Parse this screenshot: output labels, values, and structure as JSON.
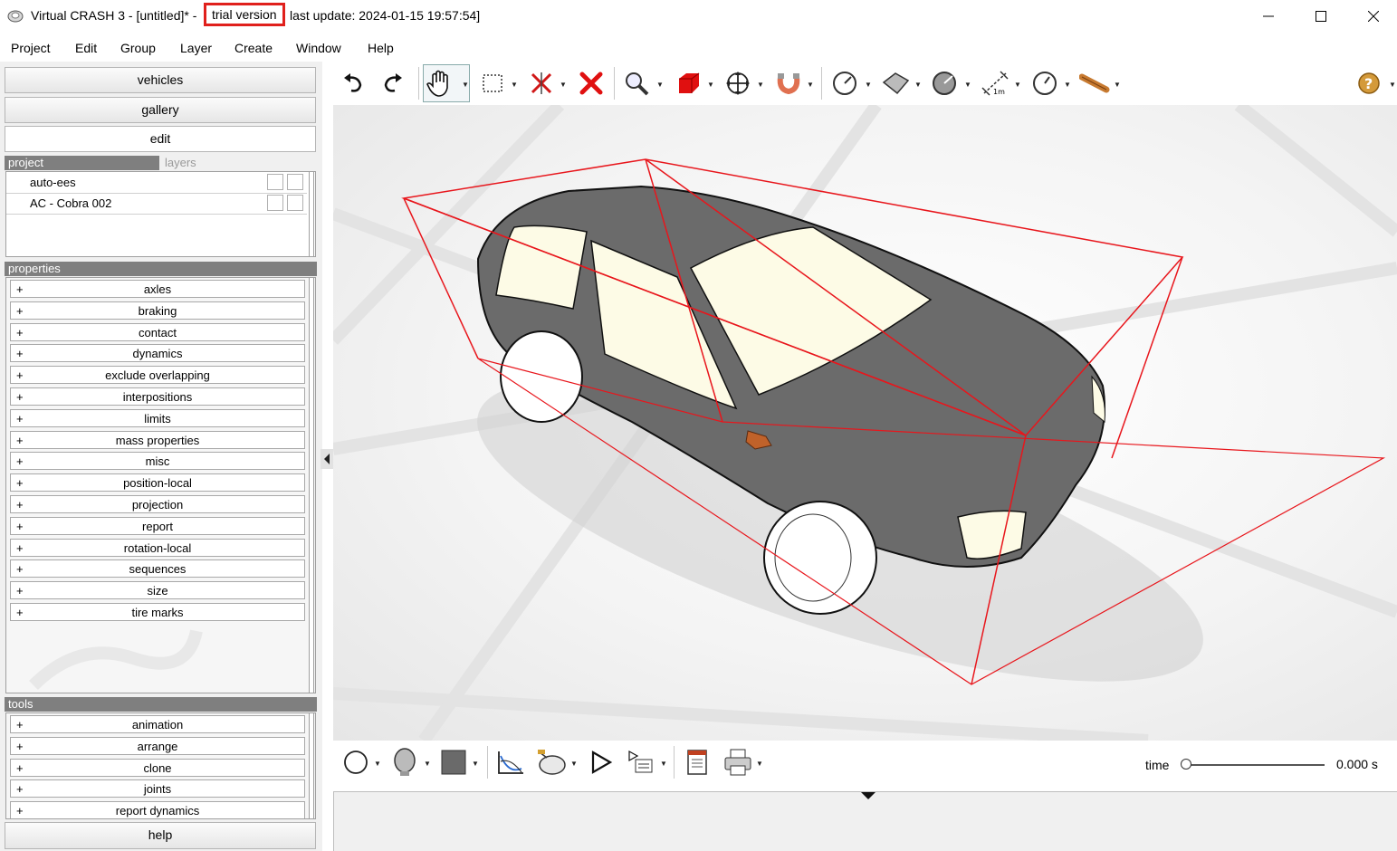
{
  "titlebar": {
    "title": "Virtual CRASH 3 - [untitled]* -",
    "trial": "trial version",
    "update": "last update: 2024-01-15 19:57:54]",
    "buttons": [
      "minimize-icon",
      "maximize-icon",
      "close-icon"
    ]
  },
  "menu": [
    "Project",
    "Edit",
    "Group",
    "Layer",
    "Create",
    "Window",
    "Help"
  ],
  "left": {
    "vehicles": "vehicles",
    "gallery": "gallery",
    "edit": "edit",
    "tab_project": "project",
    "tab_layers": "layers",
    "project_items": [
      "auto-ees",
      "AC - Cobra 002"
    ],
    "properties_header": "properties",
    "properties": [
      "axles",
      "braking",
      "contact",
      "dynamics",
      "exclude overlapping",
      "interpositions",
      "limits",
      "mass properties",
      "misc",
      "position-local",
      "projection",
      "report",
      "rotation-local",
      "sequences",
      "size",
      "tire marks"
    ],
    "tools_header": "tools",
    "tools": [
      "animation",
      "arrange",
      "clone",
      "joints",
      "report dynamics"
    ],
    "help": "help",
    "plus": "+"
  },
  "toolbar_icons": [
    "undo-icon",
    "redo-icon",
    "pan-hand-icon",
    "select-rect-icon",
    "split-icon",
    "delete-icon",
    "zoom-icon",
    "box-object-icon",
    "move-icon",
    "magnet-icon",
    "speed-gauge-icon",
    "surface-icon",
    "angle-icon",
    "measure-icon",
    "clock-icon",
    "ruler-tool-icon",
    "help-icon"
  ],
  "bottom": {
    "time_label": "time",
    "time_value": "0.000 s",
    "time_fraction": 0,
    "icons": [
      "sphere-icon",
      "head-icon",
      "color-square-icon",
      "graph-icon",
      "camera-icon",
      "play-icon",
      "video-list-icon",
      "report-icon",
      "print-icon"
    ]
  },
  "colors": {
    "accent": "#e0201c",
    "car_body": "#6b6b6b",
    "windows": "#fdfbe6",
    "bounding_box": "#e8161c"
  }
}
